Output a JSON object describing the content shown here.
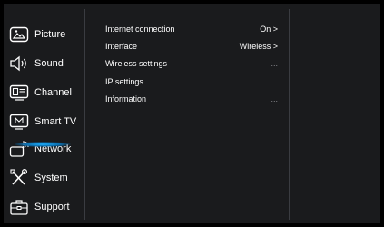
{
  "sidebar": {
    "items": [
      {
        "label": "Picture",
        "icon": "picture-icon"
      },
      {
        "label": "Sound",
        "icon": "speaker-icon"
      },
      {
        "label": "Channel",
        "icon": "channel-icon"
      },
      {
        "label": "Smart TV",
        "icon": "smart-tv-icon"
      },
      {
        "label": "Network",
        "icon": "network-icon",
        "selected": true
      },
      {
        "label": "System",
        "icon": "tools-icon"
      },
      {
        "label": "Support",
        "icon": "toolbox-icon"
      }
    ]
  },
  "network_menu": {
    "rows": [
      {
        "label": "Internet connection",
        "value": "On >"
      },
      {
        "label": "Interface",
        "value": "Wireless >"
      },
      {
        "label": "Wireless settings",
        "value": "..."
      },
      {
        "label": "IP settings",
        "value": "..."
      },
      {
        "label": "Information",
        "value": "..."
      }
    ]
  },
  "colors": {
    "background": "#1a1b1d",
    "accent": "#1fb1ff",
    "text": "#ffffff"
  }
}
